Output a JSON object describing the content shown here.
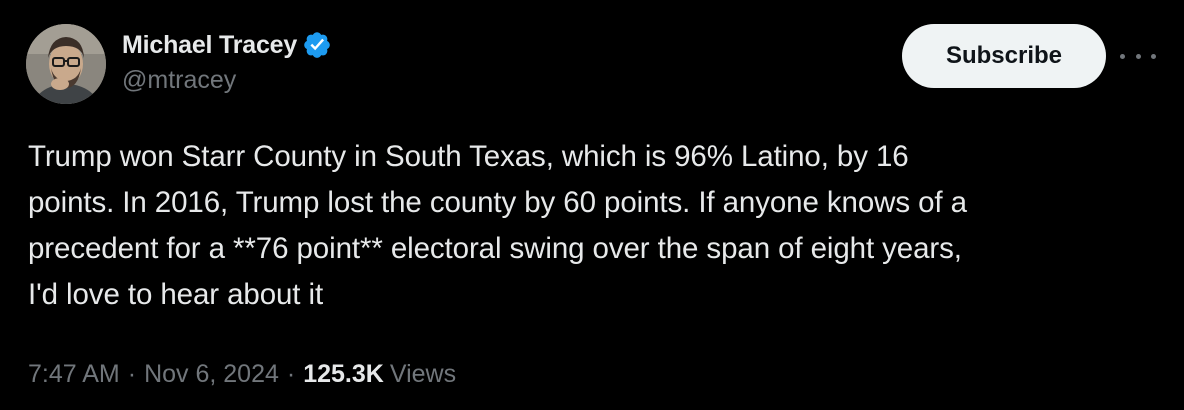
{
  "author": {
    "display_name": "Michael Tracey",
    "handle": "@mtracey",
    "verified": true,
    "avatar_icon": "profile-photo"
  },
  "actions": {
    "subscribe_label": "Subscribe",
    "more_icon": "ellipsis-icon"
  },
  "tweet": {
    "lines": [
      "Trump won Starr County in South Texas, which is 96% Latino, by 16",
      "points. In 2016, Trump lost the county by 60 points. If anyone knows of a",
      "precedent for a **76 point** electoral swing over the span of eight years,",
      "I'd love to hear about it"
    ]
  },
  "meta": {
    "time": "7:47 AM",
    "separator": "·",
    "date": "Nov 6, 2024",
    "views_count": "125.3K",
    "views_label": "Views"
  },
  "colors": {
    "background": "#000000",
    "text_primary": "#e7e9ea",
    "text_secondary": "#71767b",
    "verified_blue": "#1d9bf0",
    "button_bg": "#eff3f4"
  }
}
